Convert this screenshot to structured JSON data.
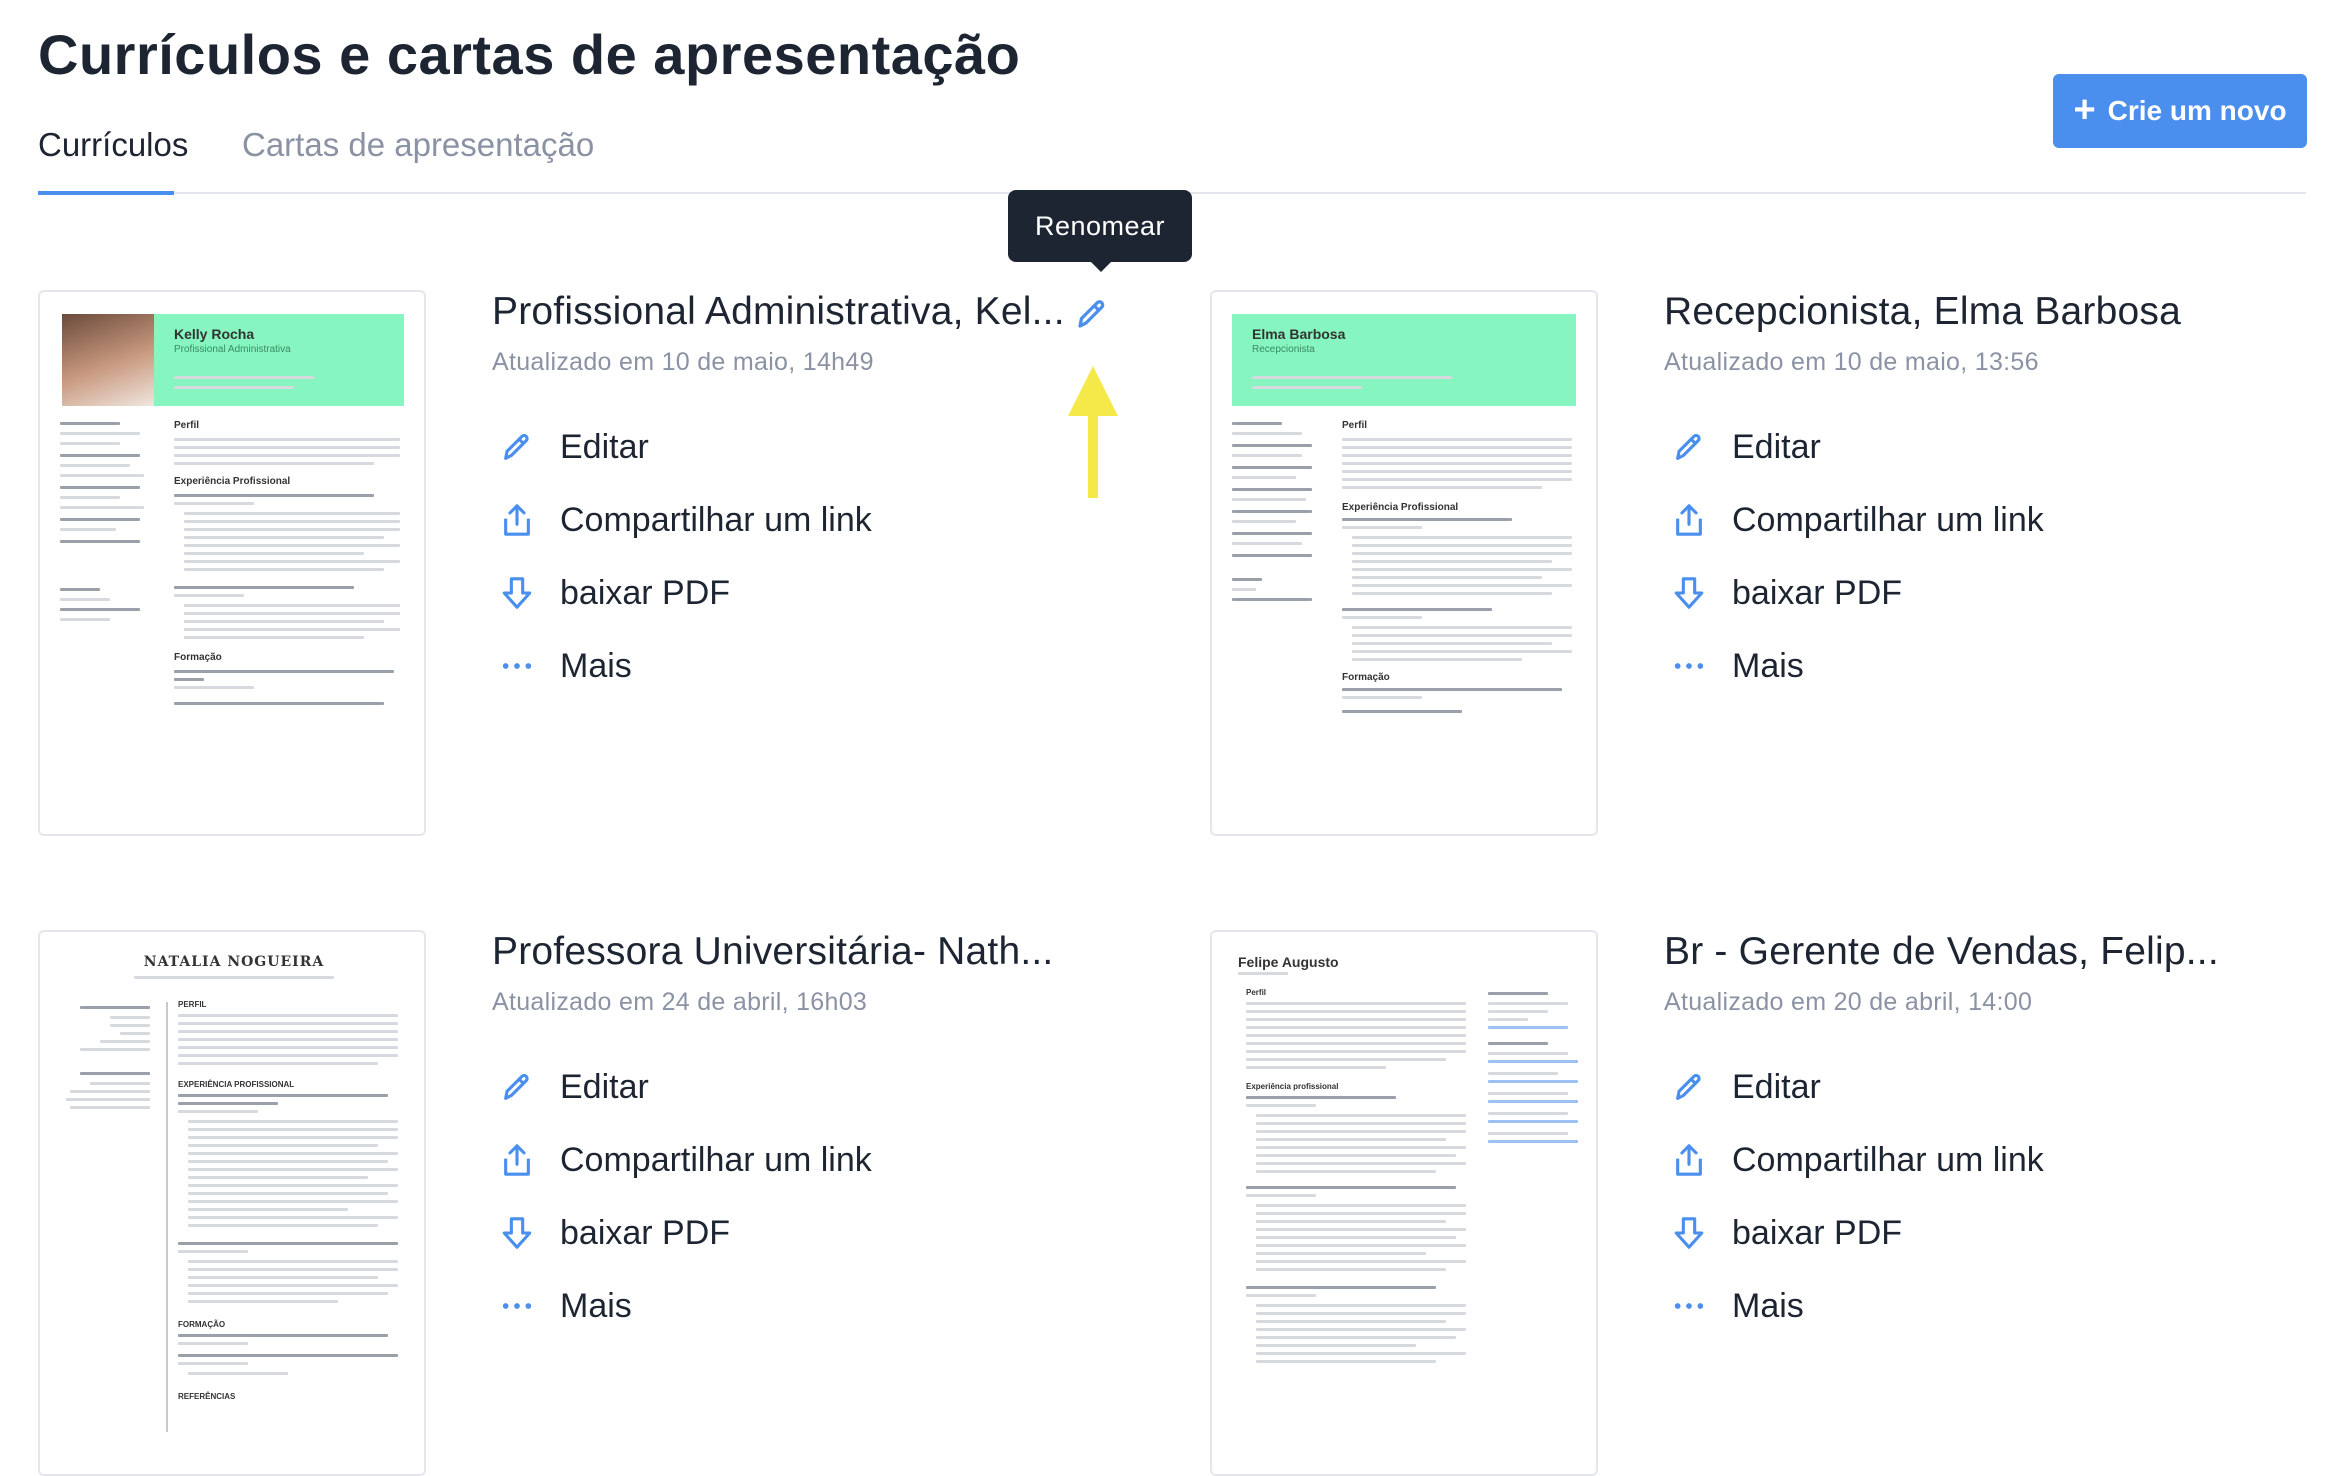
{
  "header": {
    "title": "Currículos e cartas de apresentação",
    "create_button": "Crie um novo"
  },
  "tabs": [
    {
      "label": "Currículos",
      "active": true
    },
    {
      "label": "Cartas de apresentação",
      "active": false
    }
  ],
  "tooltip": {
    "text": "Renomear"
  },
  "colors": {
    "accent": "#4a8fee",
    "text": "#1e2532",
    "muted": "#8a92a4",
    "thumb_header": "#86f5c0",
    "annotation_arrow": "#f5e94a"
  },
  "actions": {
    "edit": "Editar",
    "share": "Compartilhar um link",
    "download": "baixar PDF",
    "more": "Mais"
  },
  "icons": {
    "edit": "pencil-icon",
    "share": "share-upload-icon",
    "download": "download-arrow-icon",
    "more": "ellipsis-icon",
    "rename": "pencil-icon"
  },
  "resumes": [
    {
      "title": "Profissional Administrativa, Kel...",
      "updated": "Atualizado em 10 de maio, 14h49",
      "thumb_name": "Kelly Rocha",
      "thumb_role": "Profissional Administrativa",
      "thumb_headings": [
        "Perfil",
        "Experiência Profissional",
        "Formação"
      ]
    },
    {
      "title": "Recepcionista, Elma Barbosa",
      "updated": "Atualizado em 10 de maio, 13:56",
      "thumb_name": "Elma Barbosa",
      "thumb_role": "Recepcionista",
      "thumb_headings": [
        "Perfil",
        "Experiência Profissional",
        "Formação"
      ]
    },
    {
      "title": "Professora Universitária- Nath...",
      "updated": "Atualizado em 24 de abril, 16h03",
      "thumb_name": "NATALIA NOGUEIRA",
      "thumb_role": "",
      "thumb_headings": [
        "PERFIL",
        "EXPERIÊNCIA PROFISSIONAL",
        "FORMAÇÃO",
        "REFERÊNCIAS"
      ]
    },
    {
      "title": "Br - Gerente de Vendas, Felip...",
      "updated": "Atualizado em 20 de abril, 14:00",
      "thumb_name": "Felipe Augusto",
      "thumb_role": "",
      "thumb_headings": [
        "Perfil",
        "Experiência profissional"
      ]
    }
  ]
}
